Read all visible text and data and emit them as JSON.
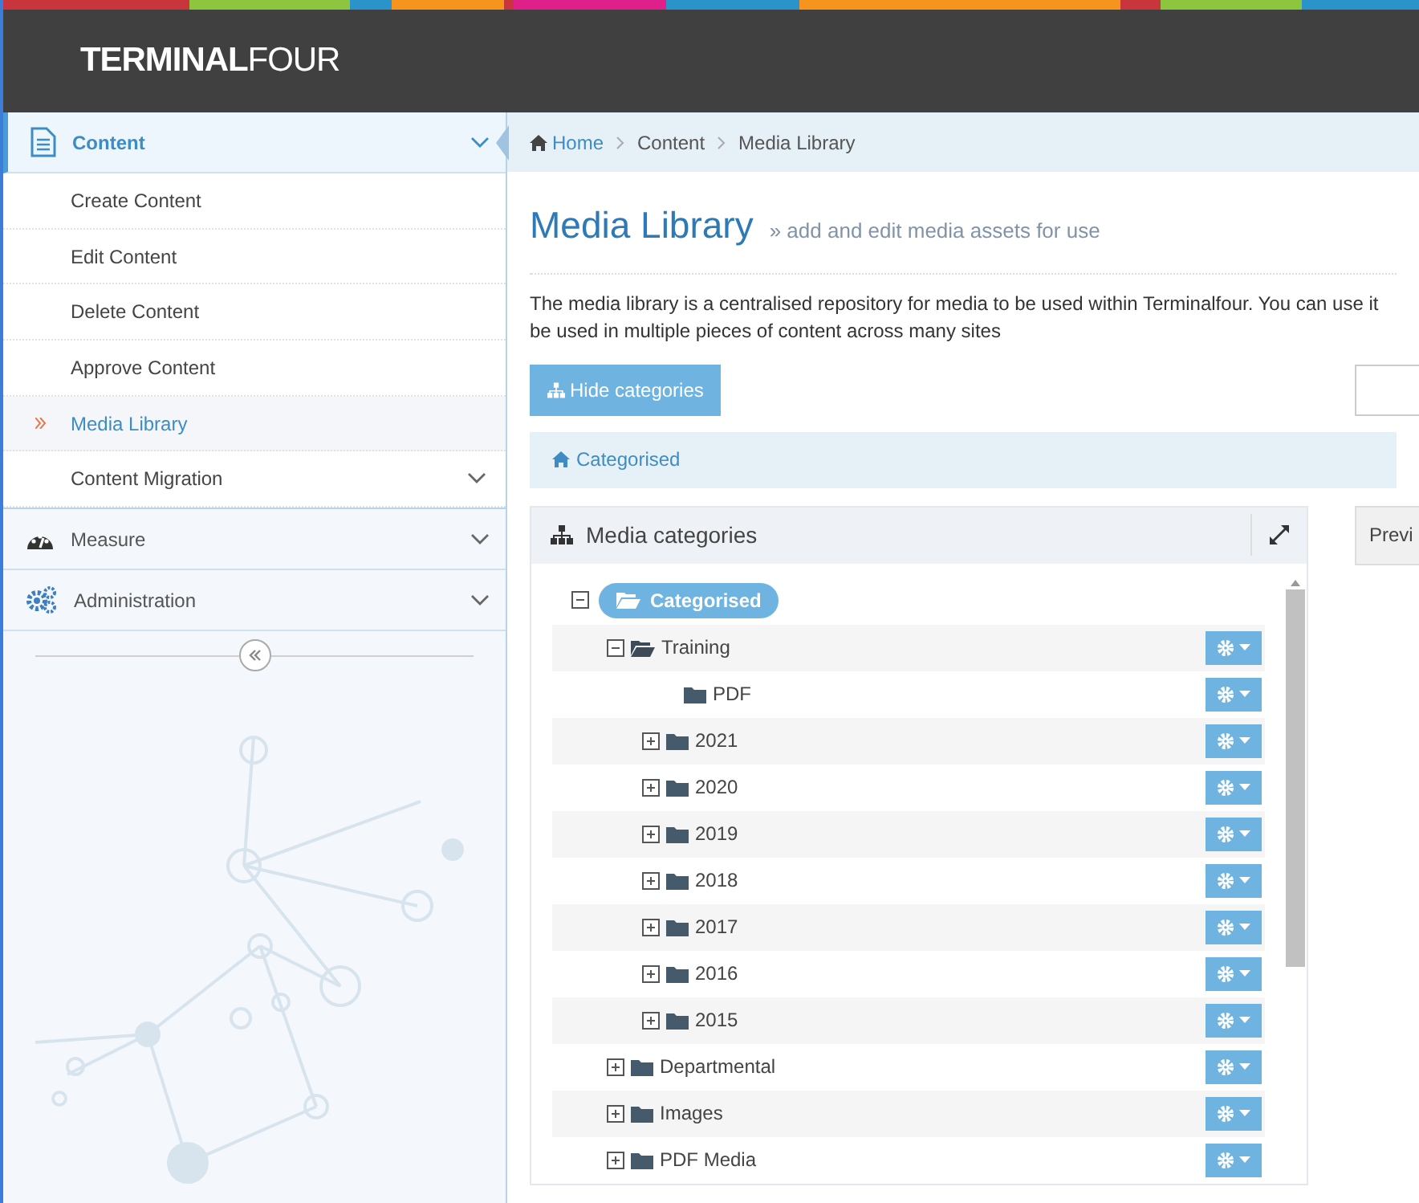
{
  "header": {
    "logo_bold": "TERMINAL",
    "logo_light": "FOUR"
  },
  "sidebar": {
    "sections": [
      {
        "label": "Content",
        "expanded": true,
        "children": [
          {
            "label": "Create Content",
            "selected": false
          },
          {
            "label": "Edit Content",
            "selected": false
          },
          {
            "label": "Delete Content",
            "selected": false
          },
          {
            "label": "Approve Content",
            "selected": false
          },
          {
            "label": "Media Library",
            "selected": true
          },
          {
            "label": "Content Migration",
            "selected": false,
            "expandable": true
          }
        ]
      },
      {
        "label": "Measure",
        "expanded": false
      },
      {
        "label": "Administration",
        "expanded": false
      }
    ]
  },
  "breadcrumb": [
    "Home",
    "Content",
    "Media Library"
  ],
  "page": {
    "title": "Media Library",
    "subtitle": "» add and edit media assets for use",
    "description": "The media library is a centralised repository for media to be used within Terminalfour. You can use it\nbe used in multiple pieces of content across many sites"
  },
  "hide_categories_button": "Hide categories",
  "category_path": "Categorised",
  "panel": {
    "title": "Media categories",
    "preview_button": "Previ"
  },
  "tree": {
    "label": "Categorised",
    "expanded": true,
    "children": [
      {
        "label": "Training",
        "expanded": true,
        "children": [
          {
            "label": "PDF"
          },
          {
            "label": "2021",
            "expanded": false
          },
          {
            "label": "2020",
            "expanded": false
          },
          {
            "label": "2019",
            "expanded": false
          },
          {
            "label": "2018",
            "expanded": false
          },
          {
            "label": "2017",
            "expanded": false
          },
          {
            "label": "2016",
            "expanded": false
          },
          {
            "label": "2015",
            "expanded": false
          }
        ]
      },
      {
        "label": "Departmental",
        "expanded": false
      },
      {
        "label": "Images",
        "expanded": false
      },
      {
        "label": "PDF Media",
        "expanded": false
      }
    ]
  }
}
